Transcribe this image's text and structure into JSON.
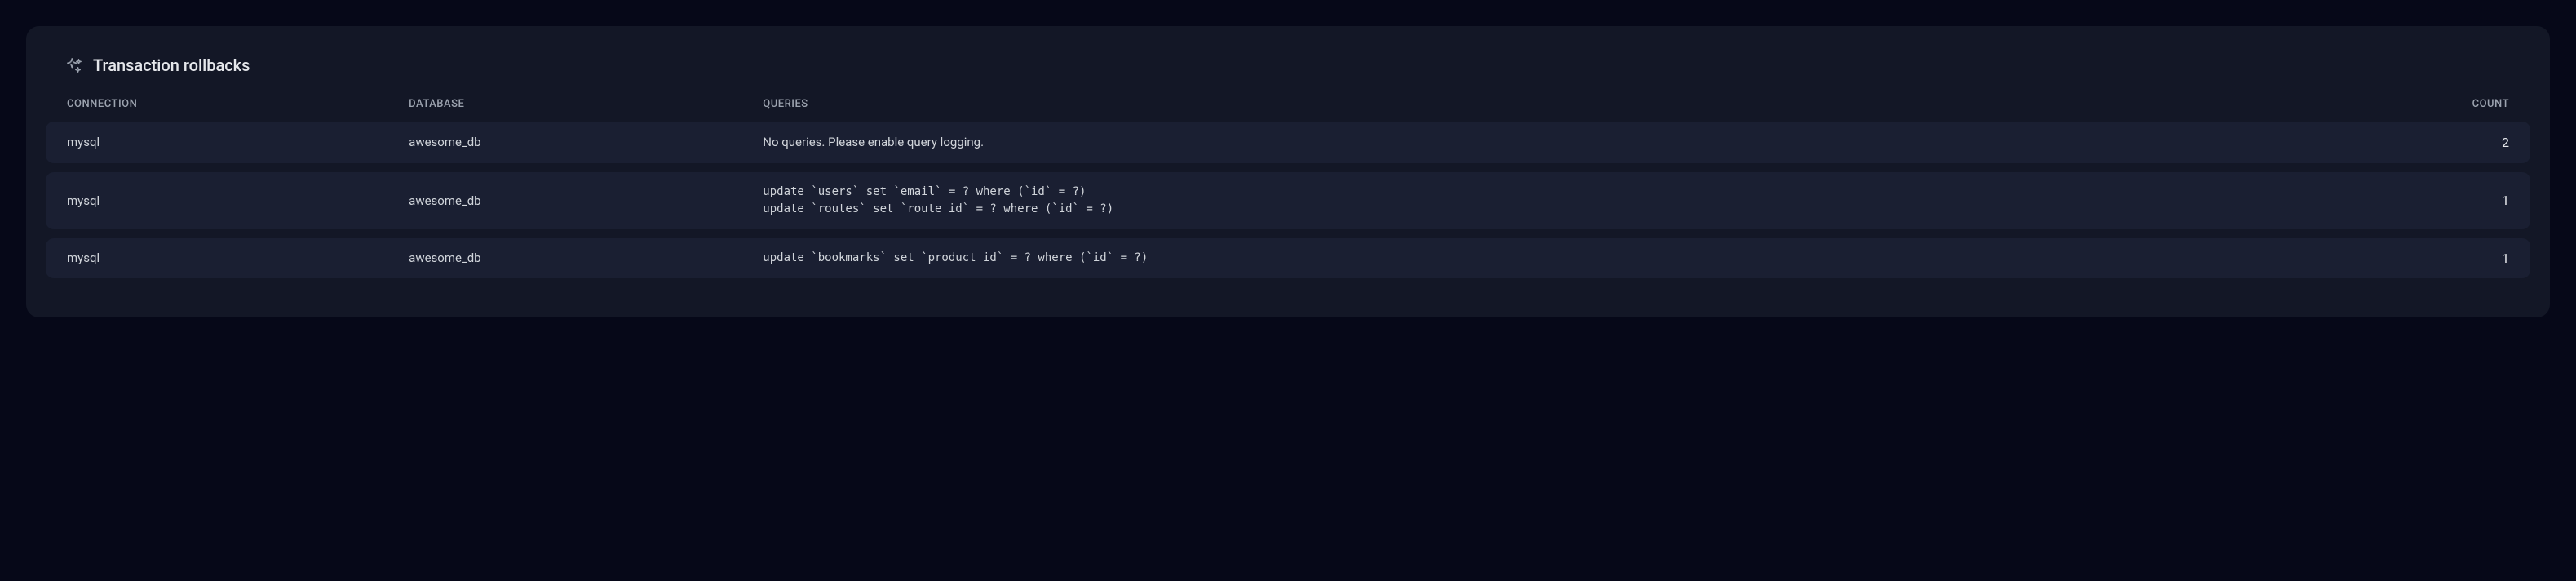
{
  "card": {
    "title": "Transaction rollbacks"
  },
  "columns": {
    "connection": "CONNECTION",
    "database": "DATABASE",
    "queries": "QUERIES",
    "count": "COUNT"
  },
  "rows": [
    {
      "connection": "mysql",
      "database": "awesome_db",
      "queries": "No queries. Please enable query logging.",
      "is_message": true,
      "count": "2"
    },
    {
      "connection": "mysql",
      "database": "awesome_db",
      "queries": "update `users` set `email` = ? where (`id` = ?)\nupdate `routes` set `route_id` = ? where (`id` = ?)",
      "is_message": false,
      "count": "1"
    },
    {
      "connection": "mysql",
      "database": "awesome_db",
      "queries": "update `bookmarks` set `product_id` = ? where (`id` = ?)",
      "is_message": false,
      "count": "1"
    }
  ]
}
